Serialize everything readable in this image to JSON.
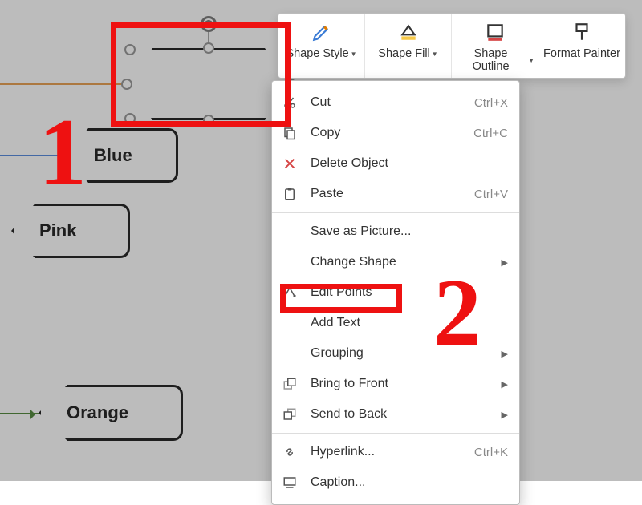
{
  "shapes": {
    "selected": "",
    "blue": "Blue",
    "pink": "Pink",
    "orange": "Orange"
  },
  "ribbon": [
    {
      "label": "Shape Style",
      "dropdown": true,
      "icon": "brush"
    },
    {
      "label": "Shape Fill",
      "dropdown": true,
      "icon": "fill"
    },
    {
      "label": "Shape Outline",
      "dropdown": true,
      "icon": "outline"
    },
    {
      "label": "Format Painter",
      "dropdown": false,
      "icon": "painter"
    }
  ],
  "menu": [
    {
      "label": "Cut",
      "shortcut": "Ctrl+X",
      "icon": "cut"
    },
    {
      "label": "Copy",
      "shortcut": "Ctrl+C",
      "icon": "copy"
    },
    {
      "label": "Delete Object",
      "icon": "delete"
    },
    {
      "label": "Paste",
      "shortcut": "Ctrl+V",
      "icon": "paste"
    },
    {
      "label": "Save as Picture..."
    },
    {
      "label": "Change Shape",
      "submenu": true
    },
    {
      "label": "Edit Points",
      "icon": "editpoints"
    },
    {
      "label": "Add Text"
    },
    {
      "label": "Grouping",
      "submenu": true
    },
    {
      "label": "Bring to Front",
      "submenu": true,
      "icon": "bringfront"
    },
    {
      "label": "Send to Back",
      "submenu": true,
      "icon": "sendback"
    },
    {
      "label": "Hyperlink...",
      "shortcut": "Ctrl+K",
      "icon": "link"
    },
    {
      "label": "Caption...",
      "icon": "caption"
    }
  ],
  "callouts": {
    "one": "1",
    "two": "2"
  }
}
